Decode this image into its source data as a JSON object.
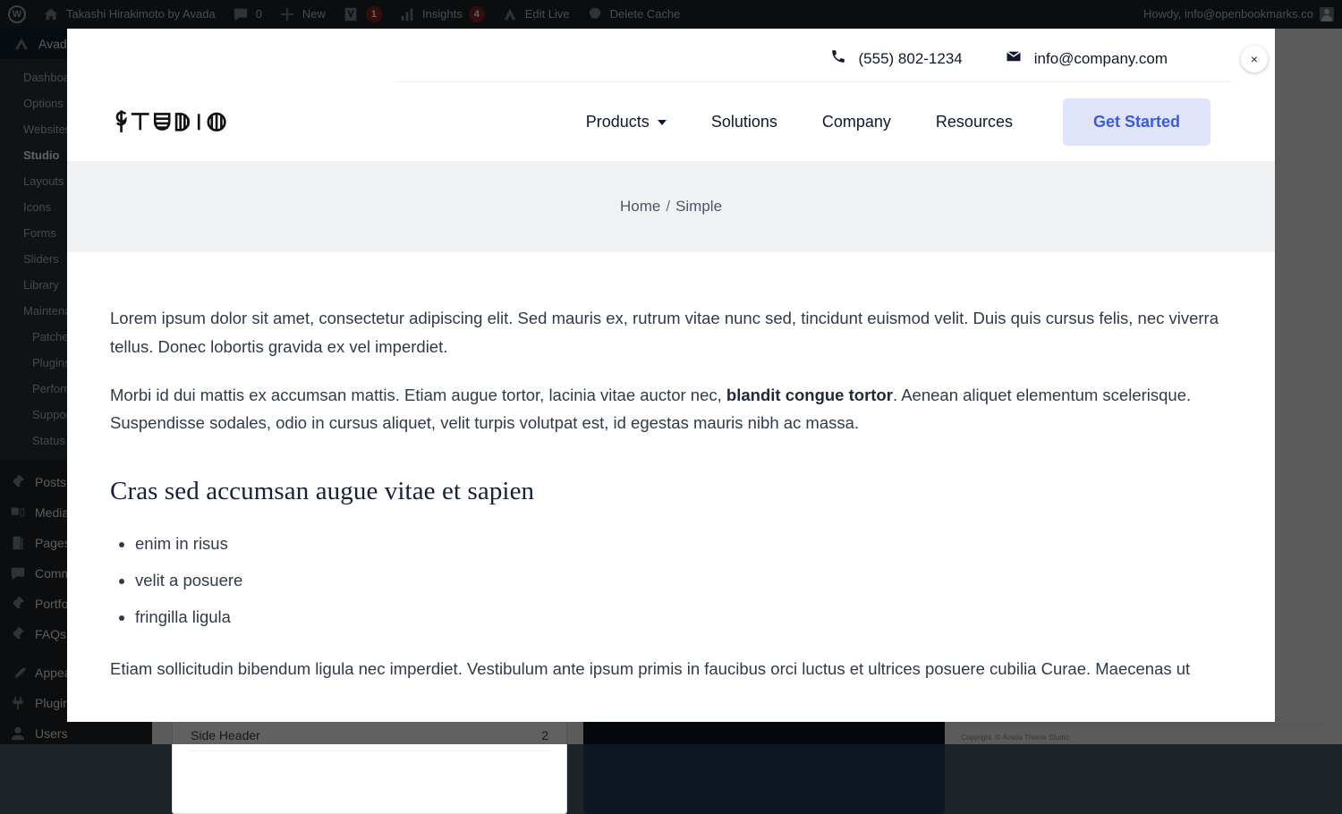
{
  "adminbar": {
    "logo_icon": "wordpress-logo-icon",
    "site_icon": "home-icon",
    "site_name": "Takashi Hirakimoto by Avada",
    "comments_icon": "comment-bubble-icon",
    "comments_count": "0",
    "new_icon": "plus-icon",
    "new_label": "New",
    "yoast_icon": "yoast-seo-icon",
    "yoast_count": "1",
    "insights_icon": "bar-chart-icon",
    "insights_label": "Insights",
    "insights_count": "4",
    "editlive_icon": "avada-triangle-icon",
    "editlive_label": "Edit Live",
    "cache_icon": "cache-rocket-icon",
    "cache_label": "Delete Cache",
    "account_label": "Howdy, info@openbookmarks.co",
    "avatar_icon": "user-avatar-icon"
  },
  "adminmenu": {
    "avada_label": "Avada",
    "avada_icon": "avada-logo-icon",
    "avada_submenu": [
      {
        "label": "Dashboard",
        "current": false,
        "indent": false
      },
      {
        "label": "Options",
        "current": false,
        "indent": false
      },
      {
        "label": "Websites",
        "current": false,
        "indent": false
      },
      {
        "label": "Studio",
        "current": true,
        "indent": false
      },
      {
        "label": "Layouts",
        "current": false,
        "indent": false
      },
      {
        "label": "Icons",
        "current": false,
        "indent": false
      },
      {
        "label": "Forms",
        "current": false,
        "indent": false
      },
      {
        "label": "Sliders",
        "current": false,
        "indent": false
      },
      {
        "label": "Library",
        "current": false,
        "indent": false
      },
      {
        "label": "Maintenance",
        "current": false,
        "indent": false
      },
      {
        "label": "Patcher",
        "current": false,
        "indent": true
      },
      {
        "label": "Plugins & Add-ons",
        "current": false,
        "indent": true
      },
      {
        "label": "Performance",
        "current": false,
        "indent": true
      },
      {
        "label": "Support",
        "current": false,
        "indent": true
      },
      {
        "label": "Status",
        "current": false,
        "indent": true
      }
    ],
    "items": [
      {
        "label": "Posts",
        "icon": "pin-icon"
      },
      {
        "label": "Media",
        "icon": "media-icon"
      },
      {
        "label": "Pages",
        "icon": "pages-icon"
      },
      {
        "label": "Comments",
        "icon": "comment-bubble-icon"
      },
      {
        "label": "Portfolio",
        "icon": "pin-icon"
      },
      {
        "label": "FAQs",
        "icon": "pin-icon"
      },
      {
        "label": "Appearance",
        "icon": "paintbrush-icon"
      },
      {
        "label": "Plugins",
        "icon": "plug-icon"
      },
      {
        "label": "Users",
        "icon": "user-icon"
      }
    ]
  },
  "background_page": {
    "row_label": "Side Header",
    "row_value": "2",
    "watermark": "img/company.com",
    "copyright": "Copyright. © Avada Theme Studio"
  },
  "modal": {
    "close_icon": "close-icon",
    "close_label": "×"
  },
  "site": {
    "topbar": {
      "phone_icon": "phone-icon",
      "phone": "(555) 802-1234",
      "email_icon": "envelope-icon",
      "email": "info@company.com"
    },
    "logo": {
      "icon": "studio-wordmark-logo",
      "text": "STUDIO"
    },
    "nav": [
      {
        "label": "Products",
        "has_dropdown": true
      },
      {
        "label": "Solutions",
        "has_dropdown": false
      },
      {
        "label": "Company",
        "has_dropdown": false
      },
      {
        "label": "Resources",
        "has_dropdown": false
      }
    ],
    "cta_label": "Get Started",
    "cta_bg": "#dfe4fb",
    "cta_color": "#3b5bdb",
    "breadcrumb": {
      "home": "Home",
      "separator": "/",
      "current": "Simple"
    },
    "article": {
      "p1": "Lorem ipsum dolor sit amet, consectetur adipiscing elit. Sed mauris ex, rutrum vitae nunc sed, tincidunt euismod velit. Duis quis cursus felis, nec viverra tellus. Donec lobortis gravida ex vel imperdiet.",
      "p2_before": "Morbi id dui mattis ex accumsan mattis. Etiam augue tortor, lacinia vitae auctor nec, ",
      "p2_bold": "blandit congue tortor",
      "p2_after": ". Aenean aliquet elementum scelerisque. Suspendisse sodales, odio in cursus aliquet, velit turpis volutpat est, id egestas mauris nibh ac massa.",
      "h2": "Cras sed accumsan augue vitae et sapien",
      "list": [
        "enim in risus",
        "velit a posuere",
        "fringilla ligula"
      ],
      "p3": "Etiam sollicitudin bibendum ligula nec imperdiet. Vestibulum ante ipsum primis in faucibus orci luctus et ultrices posuere cubilia Curae. Maecenas ut"
    }
  }
}
